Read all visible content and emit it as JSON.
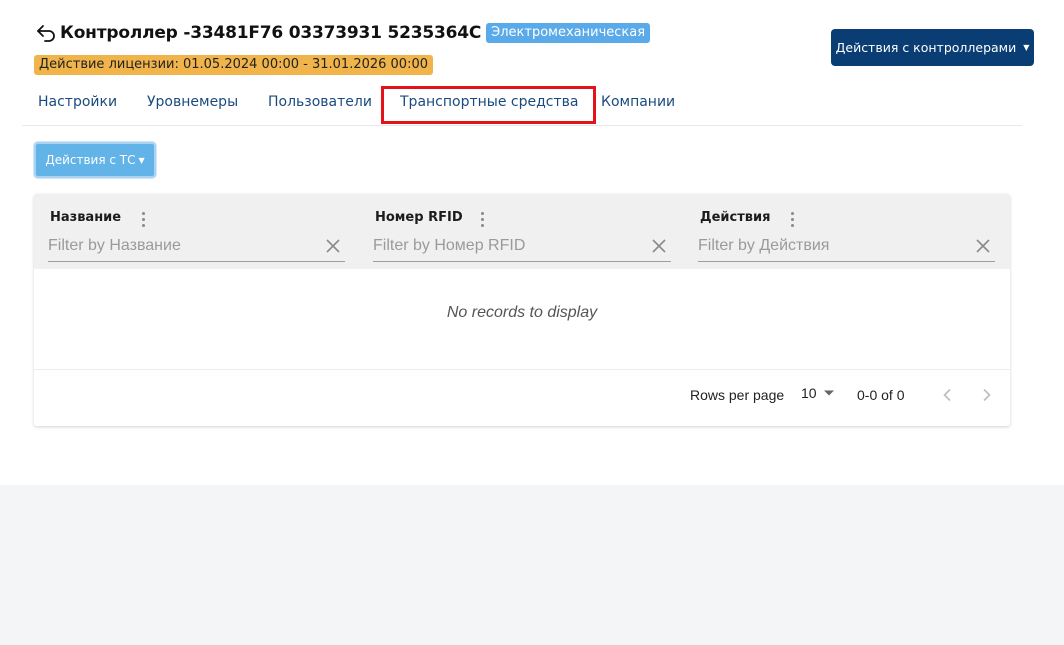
{
  "header": {
    "title": "Контроллер -33481F76 03373931 5235364C",
    "type_badge": "Электромеханическая",
    "license": "Действие лицензии: 01.05.2024 00:00 - 31.01.2026 00:00",
    "controller_actions_label": "Действия с контроллерами"
  },
  "tabs": [
    {
      "label": "Настройки"
    },
    {
      "label": "Уровнемеры"
    },
    {
      "label": "Пользователи"
    },
    {
      "label": "Транспортные средства",
      "highlighted": true
    },
    {
      "label": "Компании"
    }
  ],
  "toolbar": {
    "tc_actions_label": "Действия с ТС"
  },
  "grid": {
    "columns": [
      {
        "title": "Название",
        "filter_placeholder": "Filter by Название"
      },
      {
        "title": "Номер RFID",
        "filter_placeholder": "Filter by Номер RFID"
      },
      {
        "title": "Действия",
        "filter_placeholder": "Filter by Действия"
      }
    ],
    "empty_message": "No records to display",
    "footer": {
      "rows_per_page_label": "Rows per page",
      "rows_per_page_value": "10",
      "range": "0-0 of 0"
    }
  },
  "colors": {
    "primary_dark": "#0a3d73",
    "badge_blue": "#5aaae9",
    "license_orange": "#f0b44a",
    "tab_text": "#1a4b7f",
    "highlight_red": "#e3121b",
    "tc_button": "#62b3e8"
  },
  "icons": {
    "back": "back-arrow-icon",
    "caret": "caret-down-icon",
    "column_menu": "more-vertical-icon",
    "clear": "close-icon",
    "prev": "chevron-left-icon",
    "next": "chevron-right-icon"
  }
}
